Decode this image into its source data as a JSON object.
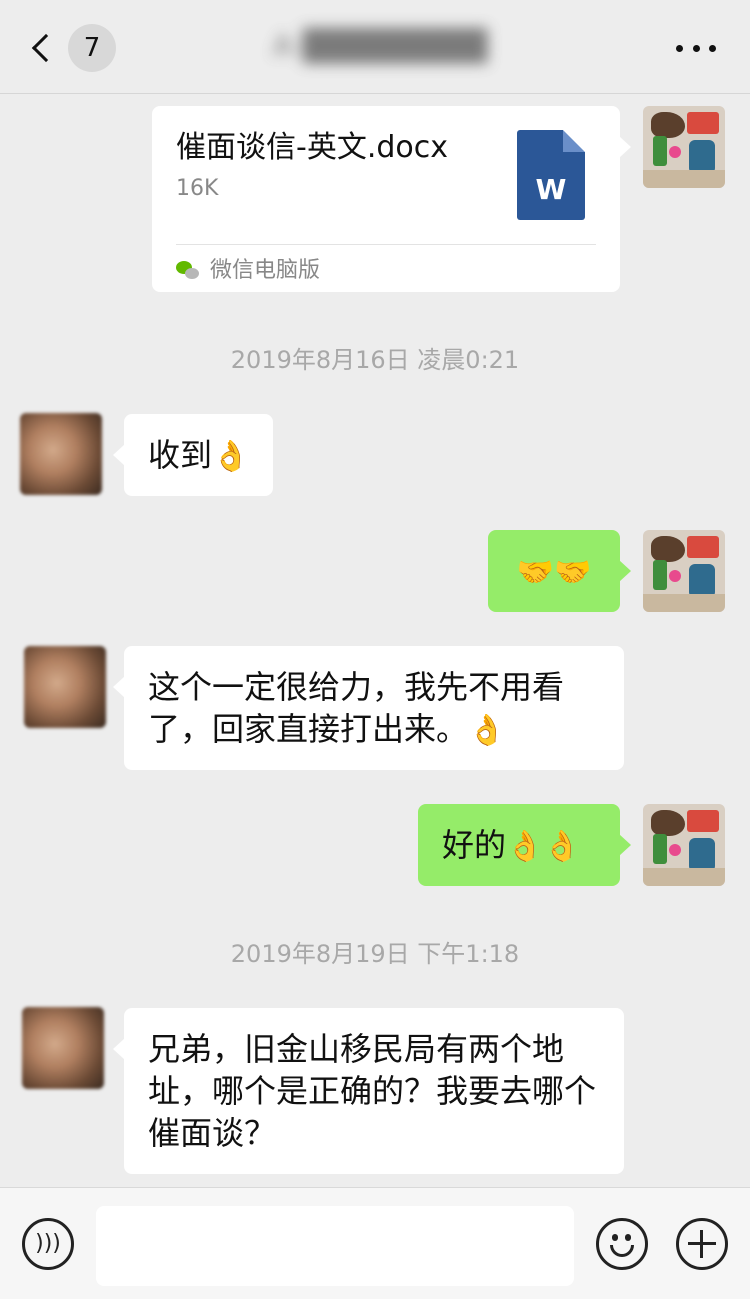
{
  "header": {
    "back_badge": "7",
    "contact_name": "A·████████"
  },
  "messages": {
    "file": {
      "name": "催面谈信-英文.docx",
      "size": "16K",
      "icon_letter": "W",
      "source": "微信电脑版"
    },
    "ts1": "2019年8月16日 凌晨0:21",
    "m1": {
      "text": "收到",
      "emoji": "👌"
    },
    "m2": {
      "emoji": "🤝🤝"
    },
    "m3": {
      "text": "这个一定很给力，我先不用看了，回家直接打出来。",
      "emoji": "👌"
    },
    "m4": {
      "text": "好的",
      "emoji": "👌👌"
    },
    "ts2": "2019年8月19日 下午1:18",
    "m5": {
      "text": "兄弟，旧金山移民局有两个地址，哪个是正确的？我要去哪个催面谈？"
    }
  },
  "input_bar": {
    "message_value": ""
  },
  "colors": {
    "background": "#ededed",
    "outgoing_bubble": "#95ec69",
    "incoming_bubble": "#ffffff",
    "word_icon": "#2b5797",
    "wechat_green": "#62b900"
  },
  "icons": [
    "back-chevron-icon",
    "more-icon",
    "word-doc-icon",
    "wechat-icon",
    "voice-icon",
    "emoji-icon",
    "plus-icon"
  ]
}
